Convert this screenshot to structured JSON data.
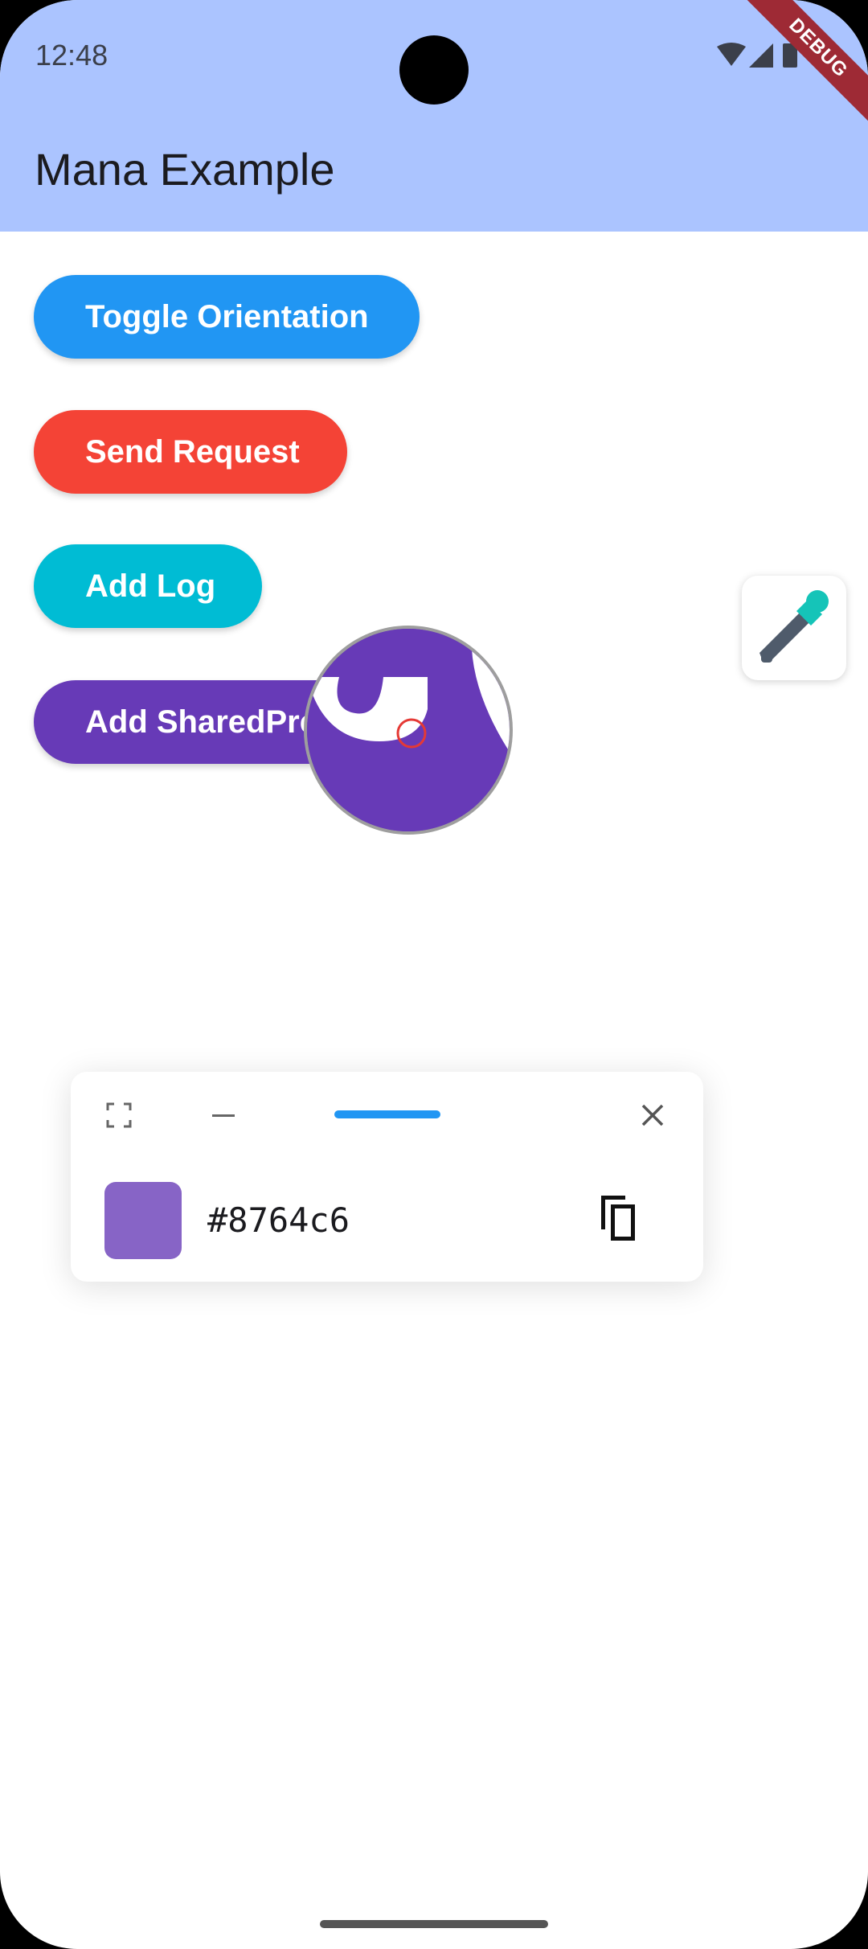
{
  "status": {
    "time": "12:48"
  },
  "app_bar": {
    "title": "Mana Example",
    "debug_label": "DEBUG"
  },
  "buttons": {
    "toggle_orientation": "Toggle Orientation",
    "send_request": "Send Request",
    "add_log": "Add Log",
    "add_shared_prefs": "Add SharedPre"
  },
  "color_picker": {
    "hex_value": "#8764c6",
    "swatch_color": "#8764c6",
    "icons": [
      "fullscreen-icon",
      "minimize-icon",
      "drag-handle",
      "close-icon",
      "copy-icon"
    ]
  },
  "colors": {
    "app_bar": "#abc4ff",
    "toggle": "#2196f3",
    "send": "#f44336",
    "log": "#00bcd4",
    "shared": "#673ab7",
    "debug_ribbon": "#9e2a35"
  }
}
